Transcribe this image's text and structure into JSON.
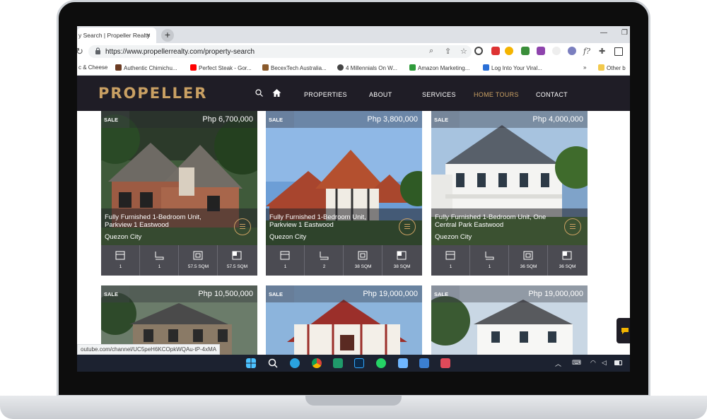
{
  "browser": {
    "tab_title": "y Search | Propeller Realty",
    "tab_close": "×",
    "new_tab": "+",
    "url": "https://www.propellerrealty.com/property-search",
    "minimize": "—",
    "restore": "❐"
  },
  "bookmarks": [
    {
      "label": "c & Cheese",
      "color": "#ffffff"
    },
    {
      "label": "Authentic Chimichu...",
      "color": "#6b3b22"
    },
    {
      "label": "Perfect Steak - Gor...",
      "color": "#ff0000"
    },
    {
      "label": "BecexTech Australia...",
      "color": "#8a5a2b"
    },
    {
      "label": "4 Millennials On W...",
      "color": "#444444"
    },
    {
      "label": "Amazon Marketing...",
      "color": "#2e9b3a"
    },
    {
      "label": "Log Into Your Viral...",
      "color": "#2a6fd6"
    },
    {
      "label": "»",
      "color": ""
    },
    {
      "label": "Other b",
      "color": "#f2c94c"
    }
  ],
  "site": {
    "logo": "PROPELLER",
    "nav": [
      {
        "label": "PROPERTIES",
        "active": false
      },
      {
        "label": "ABOUT",
        "active": false
      },
      {
        "label": "SERVICES",
        "active": false
      },
      {
        "label": "HOME TOURS",
        "active": true
      },
      {
        "label": "CONTACT",
        "active": false
      }
    ],
    "colors": {
      "nav_bg": "#1f1d26",
      "accent": "#c9a063",
      "card_bg": "#4b4b52"
    }
  },
  "listings": [
    {
      "badge": "SALE",
      "price": "Php 6,700,000",
      "title": "Fully Furnished 1-Bedroom Unit, Parkview 1 Eastwood",
      "city": "Quezon City",
      "stats": [
        "1",
        "1",
        "57.5 SQM",
        "57.5 SQM"
      ]
    },
    {
      "badge": "SALE",
      "price": "Php 3,800,000",
      "title": "Fully Furnished 1-Bedroom Unit, Parkview 1 Eastwood",
      "city": "Quezon City",
      "stats": [
        "1",
        "2",
        "38 SQM",
        "38 SQM"
      ]
    },
    {
      "badge": "SALE",
      "price": "Php 4,000,000",
      "title": "Fully Furnished 1-Bedroom Unit, One Central Park Eastwood",
      "city": "Quezon City",
      "stats": [
        "1",
        "1",
        "36 SQM",
        "36 SQM"
      ]
    },
    {
      "badge": "SALE",
      "price": "Php 10,500,000"
    },
    {
      "badge": "SALE",
      "price": "Php 19,000,000"
    },
    {
      "badge": "SALE",
      "price": "Php 19,000,000"
    }
  ],
  "status_url": "outube.com/channel/UC5peH6KCOpkWQAu-tP-4xMA",
  "taskbar": {
    "apps": [
      "windows-start",
      "search",
      "telegram",
      "chrome",
      "app-green",
      "photoshop",
      "whatsapp",
      "notepad",
      "photos",
      "snipping"
    ]
  }
}
